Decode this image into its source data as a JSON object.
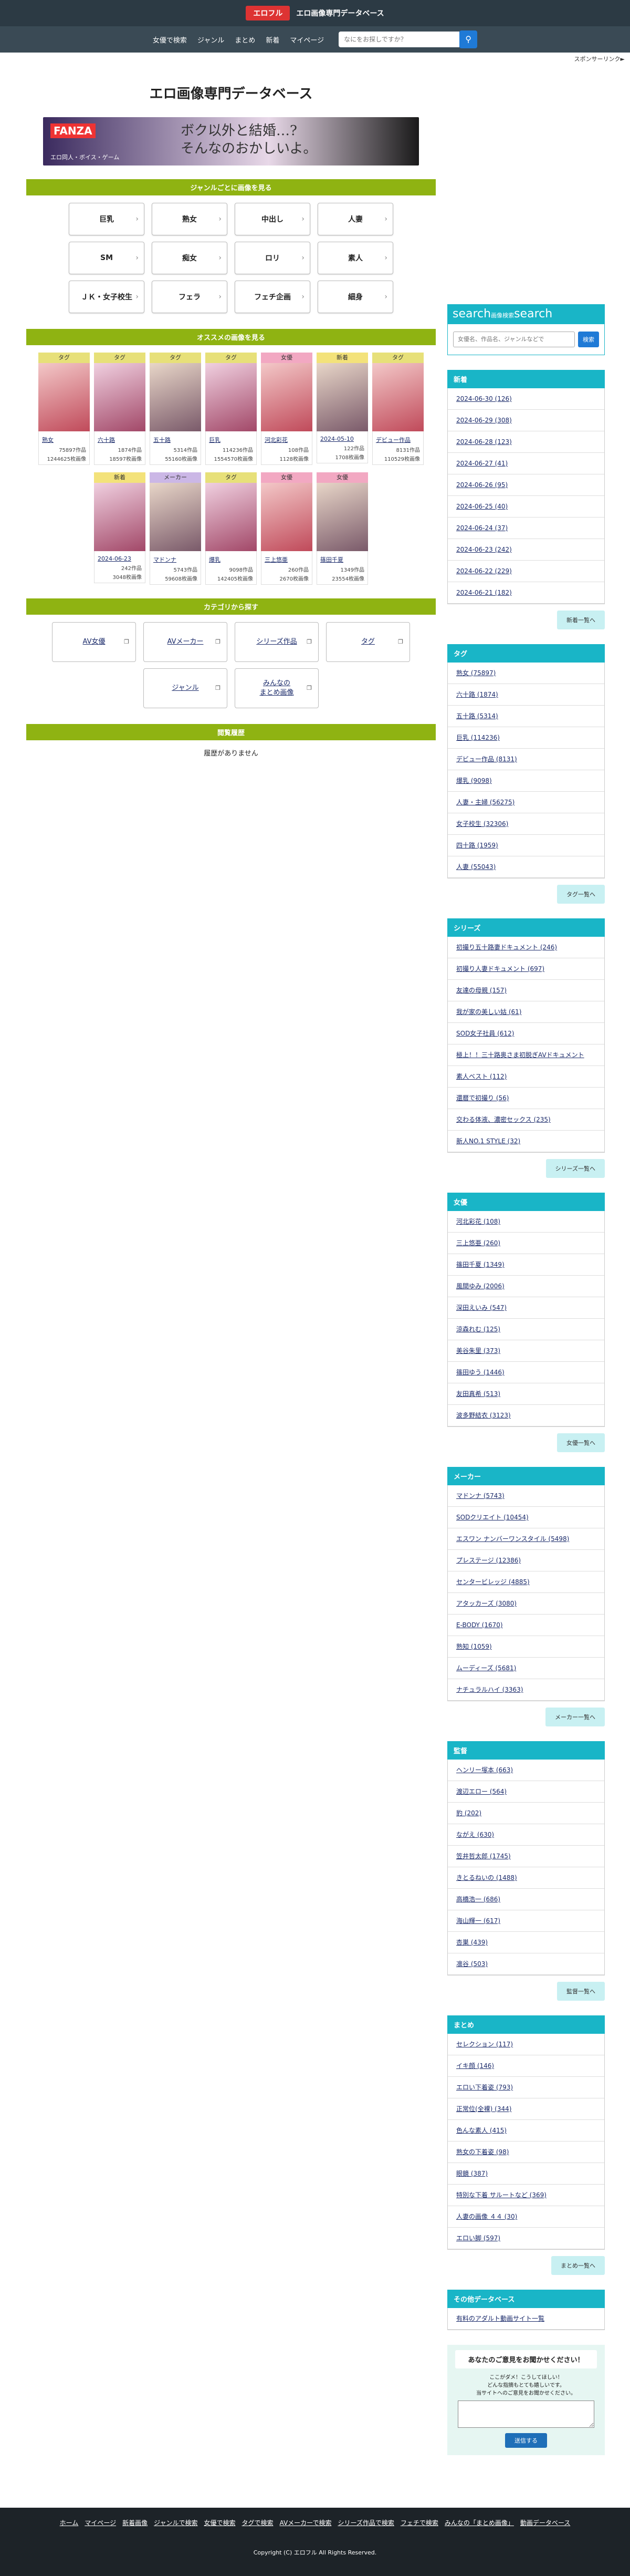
{
  "header": {
    "badge": "エロフル",
    "title": "エロ画像専門データベース"
  },
  "nav": {
    "items": [
      "女優で検索",
      "ジャンル",
      "まとめ",
      "新着",
      "マイページ"
    ],
    "search_placeholder": "なにをお探しですか？",
    "search_icon": "search-icon"
  },
  "sponsor_label": "スポンサーリンク&#9658;",
  "main": {
    "site_title": "エロ画像専門データベース",
    "banner": {
      "logo": "FANZA",
      "copy_line1": "ボク以外と結婚…?",
      "copy_line2": "そんなのおかしいよ。",
      "sub": "エロ同人・ボイス・ゲーム"
    },
    "genre_section": {
      "heading": "ジャンルごとに画像を見る",
      "genres": [
        "巨乳",
        "熟女",
        "中出し",
        "人妻",
        "SM",
        "痴女",
        "ロリ",
        "素人",
        "ＪＫ・女子校生",
        "フェラ",
        "フェチ企画",
        "細身"
      ]
    },
    "recommend_section": {
      "heading": "オススメの画像を見る",
      "cards": [
        {
          "tag": "タグ",
          "tag_type": "t-tag",
          "name": "熟女",
          "works": "75897作品",
          "images": "1244625枚画像"
        },
        {
          "tag": "タグ",
          "tag_type": "t-tag",
          "name": "六十路",
          "works": "1874作品",
          "images": "18597枚画像"
        },
        {
          "tag": "タグ",
          "tag_type": "t-tag",
          "name": "五十路",
          "works": "5314作品",
          "images": "55160枚画像"
        },
        {
          "tag": "タグ",
          "tag_type": "t-tag",
          "name": "巨乳",
          "works": "114236作品",
          "images": "1554570枚画像"
        },
        {
          "tag": "女優",
          "tag_type": "t-actress",
          "name": "河北彩花",
          "works": "108作品",
          "images": "1128枚画像"
        },
        {
          "tag": "新着",
          "tag_type": "t-new",
          "name": "2024-05-10",
          "works": "122作品",
          "images": "1708枚画像"
        },
        {
          "tag": "タグ",
          "tag_type": "t-tag",
          "name": "デビュー作品",
          "works": "8131作品",
          "images": "110529枚画像"
        },
        {
          "tag": "新着",
          "tag_type": "t-new",
          "name": "2024-06-23",
          "works": "242作品",
          "images": "3048枚画像"
        },
        {
          "tag": "メーカー",
          "tag_type": "t-maker",
          "name": "マドンナ",
          "works": "5743作品",
          "images": "59608枚画像"
        },
        {
          "tag": "タグ",
          "tag_type": "t-tag",
          "name": "爆乳",
          "works": "9098作品",
          "images": "142405枚画像"
        },
        {
          "tag": "女優",
          "tag_type": "t-actress",
          "name": "三上悠亜",
          "works": "260作品",
          "images": "2670枚画像"
        },
        {
          "tag": "女優",
          "tag_type": "t-actress",
          "name": "篠田千夏",
          "works": "1349作品",
          "images": "23554枚画像"
        }
      ]
    },
    "category_section": {
      "heading": "カテゴリから探す",
      "items": [
        "AV女優",
        "AVメーカー",
        "シリーズ作品",
        "タグ",
        "ジャンル",
        "みんなの\nまとめ画像"
      ]
    },
    "history_section": {
      "heading": "閲覧履歴",
      "empty": "履歴がありません"
    }
  },
  "side": {
    "search": {
      "title": "search",
      "small": "画像検索",
      "title2": "search",
      "placeholder": "女優名、作品名、ジャンルなどで",
      "button": "検索"
    },
    "boxes": [
      {
        "heading": "新着",
        "more": "新着一覧へ",
        "items": [
          "2024-06-30 (126)",
          "2024-06-29 (308)",
          "2024-06-28 (123)",
          "2024-06-27 (41)",
          "2024-06-26 (95)",
          "2024-06-25 (40)",
          "2024-06-24 (37)",
          "2024-06-23 (242)",
          "2024-06-22 (229)",
          "2024-06-21 (182)"
        ]
      },
      {
        "heading": "タグ",
        "more": "タグ一覧へ",
        "items": [
          "熟女 (75897)",
          "六十路 (1874)",
          "五十路 (5314)",
          "巨乳 (114236)",
          "デビュー作品 (8131)",
          "爆乳 (9098)",
          "人妻・主婦 (56275)",
          "女子校生 (32306)",
          "四十路 (1959)",
          "人妻 (55043)"
        ]
      },
      {
        "heading": "シリーズ",
        "more": "シリーズ一覧へ",
        "items": [
          "初撮り五十路妻ドキュメント (246)",
          "初撮り人妻ドキュメント (697)",
          "友達の母親 (157)",
          "我が家の美しい姑 (61)",
          "SOD女子社員 (612)",
          "極上！！三十路奥さま初脱ぎAVドキュメント",
          "素人ベスト (112)",
          "還暦で初撮り (56)",
          "交わる体液、濃密セックス (235)",
          "新人NO.1 STYLE (32)"
        ]
      },
      {
        "heading": "女優",
        "more": "女優一覧へ",
        "items": [
          "河北彩花 (108)",
          "三上悠亜 (260)",
          "篠田千夏 (1349)",
          "風間ゆみ (2006)",
          "深田えいみ (547)",
          "涼森れむ (125)",
          "美谷朱里 (373)",
          "篠田ゆう (1446)",
          "友田真希 (513)",
          "波多野結衣 (3123)"
        ]
      },
      {
        "heading": "メーカー",
        "more": "メーカー一覧へ",
        "items": [
          "マドンナ (5743)",
          "SODクリエイト (10454)",
          "エスワン ナンバーワンスタイル (5498)",
          "プレステージ (12386)",
          "センタービレッジ (4885)",
          "アタッカーズ (3080)",
          "E-BODY (1670)",
          "熟知 (1059)",
          "ムーディーズ (5681)",
          "ナチュラルハイ (3363)"
        ]
      },
      {
        "heading": "監督",
        "more": "監督一覧へ",
        "items": [
          "ヘンリー塚本 (663)",
          "渡辺エロー (564)",
          "豹 (202)",
          "ながえ (630)",
          "笠井哲太郎 (1745)",
          "きとるねいの (1488)",
          "高橋浩一 (686)",
          "海山輝一 (617)",
          "杏巣 (439)",
          "凛谷 (503)"
        ]
      },
      {
        "heading": "まとめ",
        "more": "まとめ一覧へ",
        "items": [
          "セレクション (117)",
          "イキ顔 (146)",
          "エロい下着姿 (793)",
          "正常位(全裸) (344)",
          "色んな素人 (415)",
          "熟女の下着姿 (98)",
          "眼鏡 (387)",
          "特別な下着 サルートなど (369)",
          "人妻の画像 ４４ (30)",
          "エロい脚 (597)"
        ]
      },
      {
        "heading": "その他データベース",
        "more": "",
        "items": [
          "有料のアダルト動画サイト一覧"
        ]
      }
    ],
    "opinion": {
      "heading": "あなたのご意見をお聞かせください！",
      "line1": "ここがダメ！こうしてほしい！",
      "line2": "どんな指摘もとても嬉しいです。",
      "line3": "当サイトへのご意見をお聞かせください。",
      "button": "送信する"
    }
  },
  "footer": {
    "links": [
      "ホーム",
      "マイページ",
      "新着画像",
      "ジャンルで検索",
      "女優で検索",
      "タグで検索",
      "AVメーカーで検索",
      "シリーズ作品で検索",
      "フェチで検索",
      "みんなの「まとめ画像」",
      "動画データベース"
    ],
    "copyright": "Copyright (C) エロフル All Rights Reserved."
  }
}
